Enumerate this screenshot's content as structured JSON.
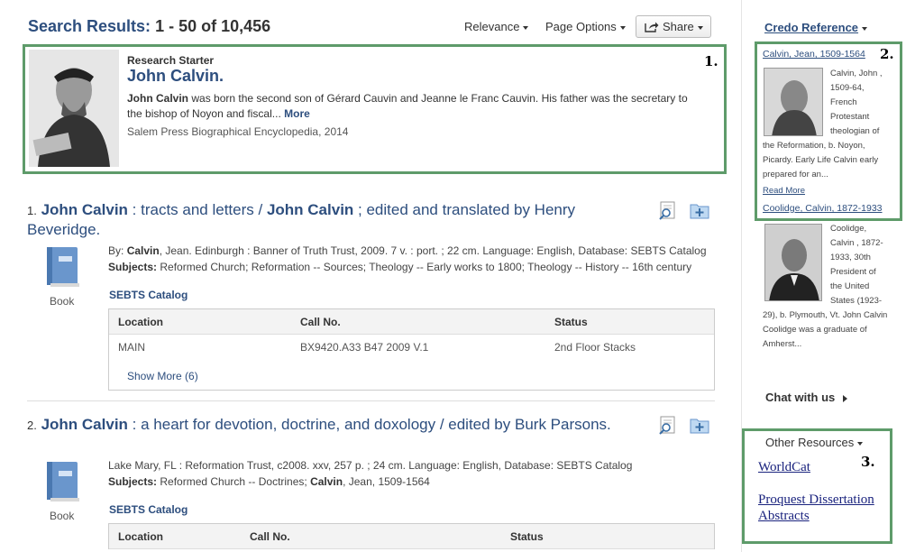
{
  "header": {
    "results_label": "Search Results:",
    "results_range": "1 - 50 of 10,456",
    "sort_label": "Relevance",
    "page_options_label": "Page Options",
    "share_label": "Share"
  },
  "research_starter": {
    "kicker": "Research Starter",
    "title": "John Calvin.",
    "desc_name": "John Calvin",
    "desc_text": " was born the second son of Gérard Cauvin and Jeanne le Franc Cauvin. His father was the secretary to the bishop of Noyon and fiscal...",
    "more_label": "More",
    "source": "Salem Press Biographical Encyclopedia, 2014",
    "badge": "1."
  },
  "results": [
    {
      "number": "1.",
      "title_parts": [
        "John Calvin",
        " : tracts and letters / ",
        "John Calvin",
        " ; edited and translated by Henry Beveridge."
      ],
      "format": "Book",
      "by_label": "By:",
      "author": "Calvin",
      "meta_rest": ", Jean. Edinburgh : Banner of Truth Trust, 2009. 7 v. : port. ; 22 cm. Language: English, Database: SEBTS Catalog",
      "subjects_label": "Subjects:",
      "subjects": "Reformed Church; Reformation -- Sources; Theology -- Early works to 1800; Theology -- History -- 16th century",
      "catalog": "SEBTS Catalog",
      "holdings_headers": [
        "Location",
        "Call No.",
        "Status"
      ],
      "holdings": [
        [
          "MAIN",
          "BX9420.A33 B47 2009 V.1",
          "2nd Floor Stacks"
        ]
      ],
      "show_more": "Show More (6)"
    },
    {
      "number": "2.",
      "title_parts": [
        "John Calvin",
        " : a heart for devotion, doctrine, and doxology / edited by Burk Parsons."
      ],
      "format": "Book",
      "meta": "Lake Mary, FL : Reformation Trust, c2008. xxv, 257 p. ; 24 cm. Language: English, Database: SEBTS Catalog",
      "subjects_label": "Subjects:",
      "subjects_pre": "Reformed Church -- Doctrines; ",
      "subjects_bold": "Calvin",
      "subjects_post": ", Jean, 1509-1564",
      "catalog": "SEBTS Catalog",
      "holdings_headers": [
        "Location",
        "Call No.",
        "Status"
      ]
    }
  ],
  "credo": {
    "title": "Credo Reference",
    "badge": "2.",
    "entry1_link": "Calvin, Jean, 1509-1564",
    "entry1_lines": [
      "Calvin, John ,",
      "1509-64,",
      "French",
      "Protestant",
      "theologian of"
    ],
    "entry1_full_lines": [
      "the Reformation, b. Noyon,",
      "Picardy. Early Life Calvin early",
      "prepared for an..."
    ],
    "read_more": "Read More",
    "entry2_link": "Coolidge, Calvin, 1872-1933",
    "entry2_lines": [
      "Coolidge,",
      "Calvin , 1872-",
      "1933, 30th",
      "President of",
      "the United",
      "States (1923-"
    ],
    "entry2_full_lines": [
      "29), b. Plymouth, Vt. John Calvin",
      "Coolidge was a graduate of",
      "Amherst..."
    ]
  },
  "chat": {
    "label": "Chat with us"
  },
  "other_resources": {
    "title": "Other Resources",
    "badge": "3.",
    "links": [
      "WorldCat",
      "Proquest Dissertation",
      "Abstracts"
    ]
  },
  "colors": {
    "accent": "#2d4e7e",
    "highlight_border": "#5e9b6a",
    "book_icon": "#6a96cc"
  }
}
